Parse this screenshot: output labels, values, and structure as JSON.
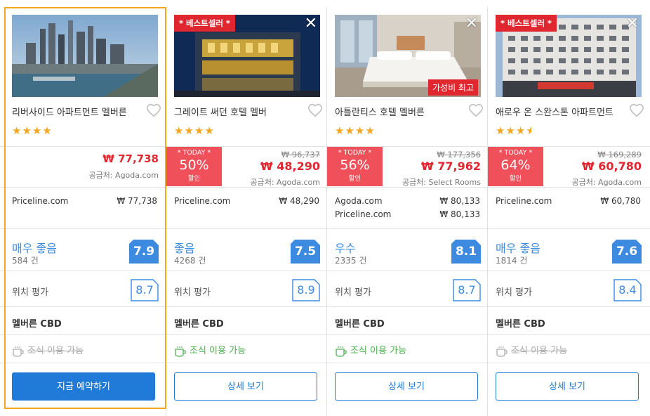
{
  "hotels": [
    {
      "name": "리버사이드 아파트먼트 멜버른",
      "stars": "★★★★",
      "price": "₩ 77,738",
      "supplier": "공급처: Agoda.com",
      "vendors": [
        {
          "name": "Priceline.com",
          "price": "₩ 77,738"
        }
      ],
      "rating_word": "매우 좋음",
      "reviews": "584 건",
      "score": "7.9",
      "location_label": "위치 평가",
      "location_score": "8.7",
      "area": "멜버른 CBD",
      "breakfast": "조식 이용 가능",
      "button": "지금 예약하기"
    },
    {
      "name": "그레이트 써던 호텔 멜버",
      "stars": "★★★★",
      "best_seller": "* 베스트셀러 *",
      "close": "✕",
      "today": "* TODAY *",
      "discount": "50%",
      "discount_off": "할인",
      "original_price": "₩ 96,737",
      "price": "₩ 48,290",
      "supplier": "공급처: Agoda.com",
      "vendors": [
        {
          "name": "Priceline.com",
          "price": "₩ 48,290"
        }
      ],
      "rating_word": "좋음",
      "reviews": "4268 건",
      "score": "7.5",
      "location_label": "위치 평가",
      "location_score": "8.9",
      "area": "멜버른 CBD",
      "breakfast": "조식 이용 가능",
      "button": "상세 보기"
    },
    {
      "name": "아틀란티스 호텔 멜버른",
      "stars": "★★★★",
      "close": "✕",
      "value_badge": "가성비 최고",
      "today": "* TODAY *",
      "discount": "56%",
      "discount_off": "할인",
      "original_price": "₩ 177,356",
      "price": "₩ 77,962",
      "supplier": "공급처: Select Rooms",
      "vendors": [
        {
          "name": "Agoda.com",
          "price": "₩ 80,133"
        },
        {
          "name": "Priceline.com",
          "price": "₩ 80,133"
        }
      ],
      "rating_word": "우수",
      "reviews": "2335 건",
      "score": "8.1",
      "location_label": "위치 평가",
      "location_score": "8.7",
      "area": "멜버른 CBD",
      "breakfast": "조식 이용 가능",
      "button": "상세 보기"
    },
    {
      "name": "애로우 온 스완스톤 아파트먼트",
      "stars": "★★★",
      "best_seller": "* 베스트셀러 *",
      "close": "✕",
      "today": "* TODAY *",
      "discount": "64%",
      "discount_off": "할인",
      "original_price": "₩ 169,289",
      "price": "₩ 60,780",
      "supplier": "공급처: Agoda.com",
      "vendors": [
        {
          "name": "Priceline.com",
          "price": "₩ 60,780"
        }
      ],
      "rating_word": "매우 좋음",
      "reviews": "1814 건",
      "score": "7.6",
      "location_label": "위치 평가",
      "location_score": "8.4",
      "area": "멜버른 CBD",
      "breakfast": "조식 이용 가능",
      "button": "상세 보기"
    }
  ],
  "colors": {
    "accent": "#1f7ad8",
    "sale": "#e0272f",
    "discount_bg": "#f0505a",
    "star": "#f5a623",
    "selected_border": "#f5a623",
    "breakfast_on": "#4caf50"
  }
}
